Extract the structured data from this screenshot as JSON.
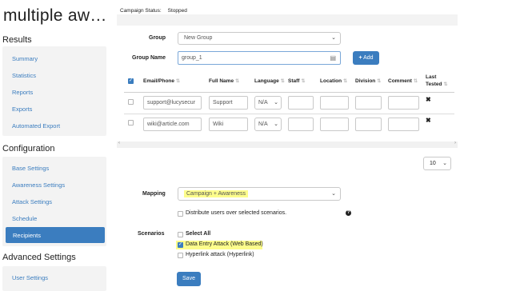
{
  "app": {
    "title": "multiple aw…"
  },
  "status": {
    "label": "Campaign Status:",
    "value": "Stopped"
  },
  "sidebar": {
    "results_title": "Results",
    "results_items": [
      "Summary",
      "Statistics",
      "Reports",
      "Exports",
      "Automated Export"
    ],
    "config_title": "Configuration",
    "config_items": [
      "Base Settings",
      "Awareness Settings",
      "Attack Settings",
      "Schedule",
      "Recipients"
    ],
    "active_item": "Recipients",
    "advanced_title": "Advanced Settings",
    "advanced_items": [
      "User Settings"
    ]
  },
  "form": {
    "group_label": "Group",
    "group_value": "New Group",
    "group_name_label": "Group Name",
    "group_name_value": "group_1",
    "add_button": "Add"
  },
  "table": {
    "headers": [
      "Email/Phone",
      "Full Name",
      "Language",
      "Staff",
      "Location",
      "Division",
      "Comment",
      "Last",
      "Tested"
    ],
    "rows": [
      {
        "email": "support@lucysecur",
        "name": "Support",
        "lang": "N/A"
      },
      {
        "email": "wiki@article.com",
        "name": "Wiki",
        "lang": "N/A"
      }
    ]
  },
  "pagination": {
    "page_size": "10"
  },
  "mapping": {
    "label": "Mapping",
    "value": "Campaign + Awareness",
    "distribute_label": "Distribute users over selected scenarios."
  },
  "scenarios": {
    "label": "Scenarios",
    "select_all": "Select All",
    "items": [
      {
        "label": "Data Entry Attack (Web Based)",
        "checked": true
      },
      {
        "label": "Hyperlink attack (Hyperlink)",
        "checked": false
      }
    ]
  },
  "save_button": "Save",
  "colors": {
    "accent": "#3b7dbf",
    "highlight": "#fdfd8c"
  }
}
